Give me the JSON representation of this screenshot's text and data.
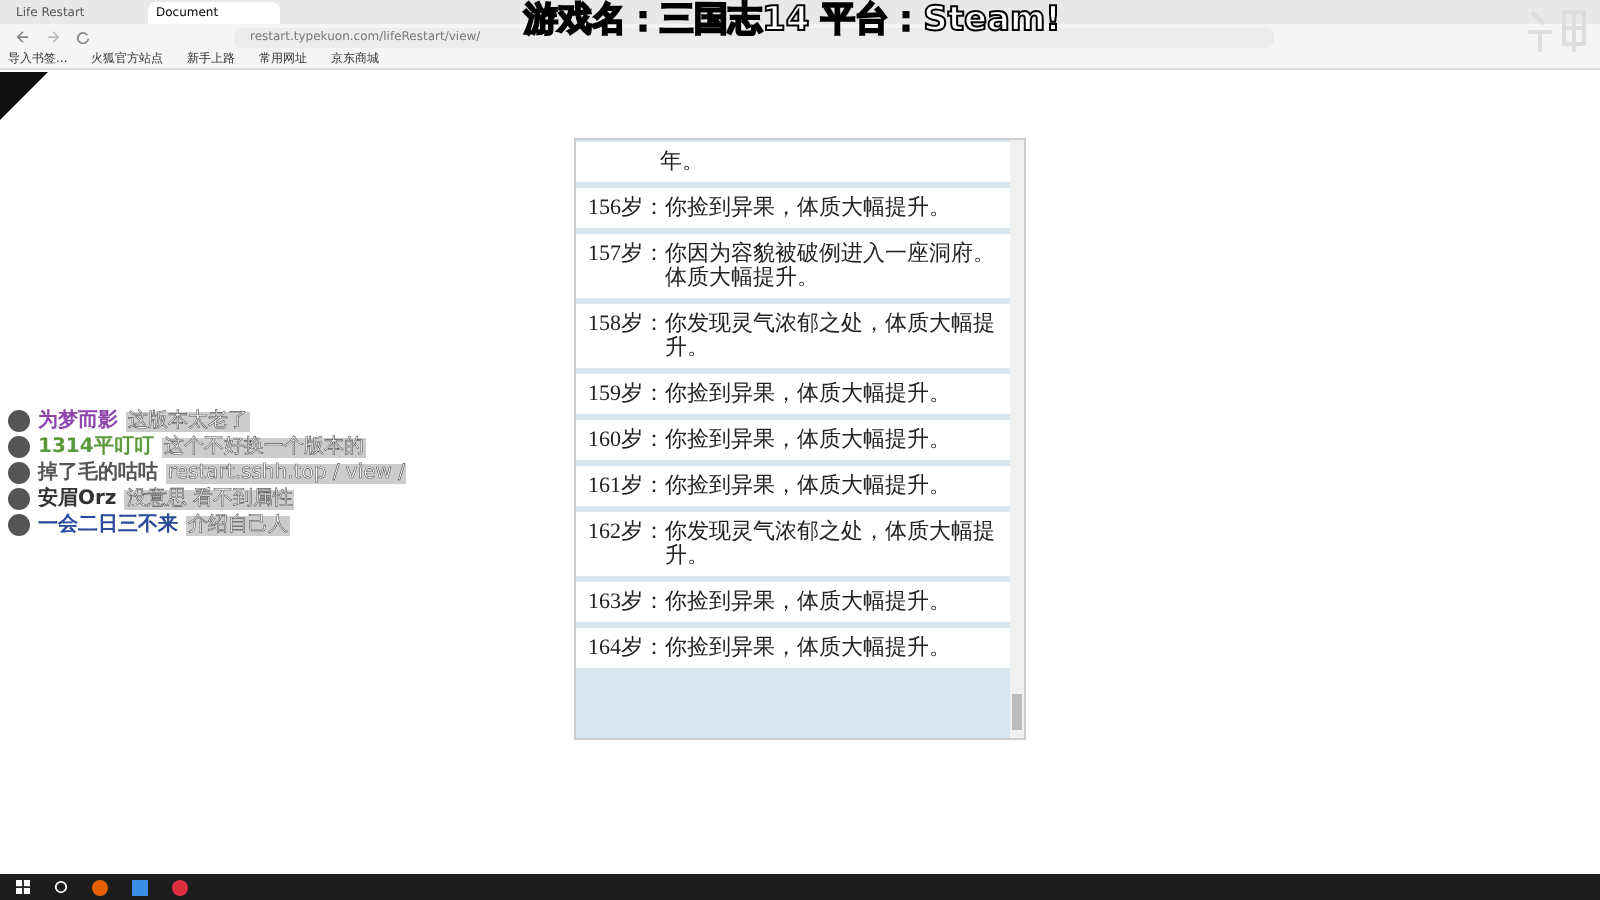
{
  "browser": {
    "tabs": [
      {
        "label": "Life Restart",
        "selected": false
      },
      {
        "label": "Document",
        "selected": true
      }
    ],
    "address": "restart.typekuon.com/lifeRestart/view/",
    "bookmarks": [
      "导入书签...",
      "火狐官方站点",
      "新手上路",
      "常用网址",
      "京东商城"
    ]
  },
  "overlay": {
    "caption": "游戏名：三国志14 平台：Steam!"
  },
  "chat": [
    {
      "user": "为梦而影",
      "message": "这版本太老了",
      "color": "#8e44ad"
    },
    {
      "user": "1314平叮叮",
      "message": "这个不好换一个版本的",
      "color": "#5a9a3a"
    },
    {
      "user": "掉了毛的咕咕",
      "message": "restart.sshh.top / view /",
      "color": "#555555"
    },
    {
      "user": "安眉Orz",
      "message": "没意思 看不到属性",
      "color": "#333333"
    },
    {
      "user": "一会二日三不来",
      "message": "介绍自己人",
      "color": "#2a4a9a"
    }
  ],
  "events": [
    {
      "text": "年。"
    },
    {
      "age": "156岁：",
      "text": "你捡到异果，体质大幅提升。"
    },
    {
      "age": "157岁：",
      "text": "你因为容貌被破例进入一座洞府。体质大幅提升。"
    },
    {
      "age": "158岁：",
      "text": "你发现灵气浓郁之处，体质大幅提升。"
    },
    {
      "age": "159岁：",
      "text": "你捡到异果，体质大幅提升。"
    },
    {
      "age": "160岁：",
      "text": "你捡到异果，体质大幅提升。"
    },
    {
      "age": "161岁：",
      "text": "你捡到异果，体质大幅提升。"
    },
    {
      "age": "162岁：",
      "text": "你发现灵气浓郁之处，体质大幅提升。"
    },
    {
      "age": "163岁：",
      "text": "你捡到异果，体质大幅提升。"
    },
    {
      "age": "164岁：",
      "text": "你捡到异果，体质大幅提升。"
    }
  ]
}
